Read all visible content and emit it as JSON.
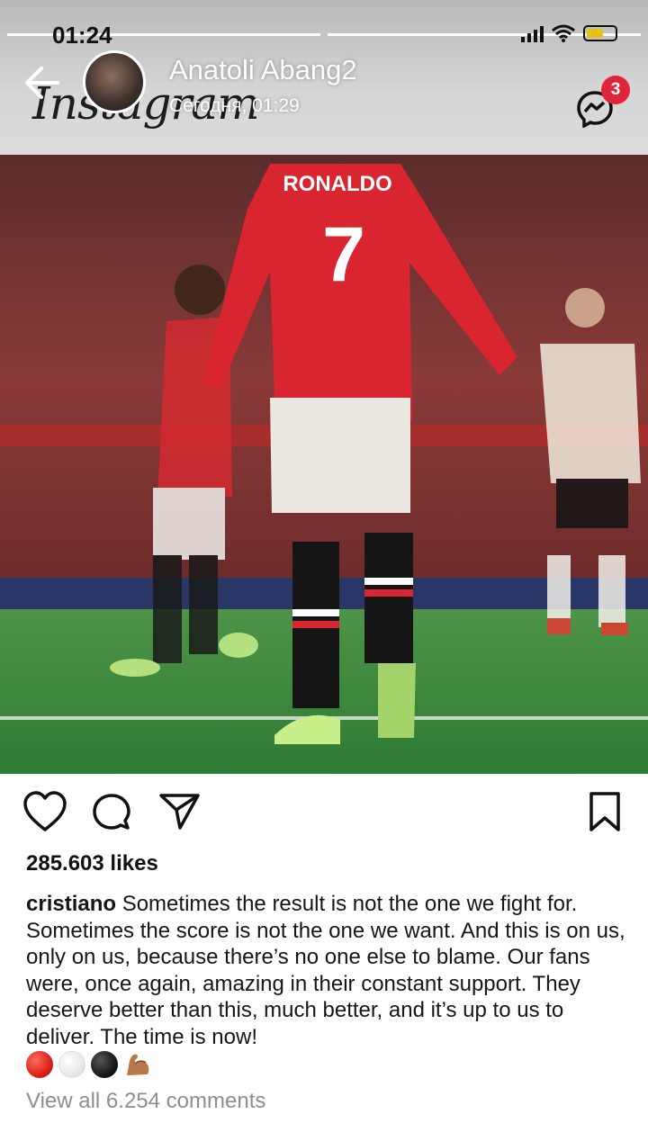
{
  "status_bar": {
    "time": "01:24"
  },
  "chat": {
    "name": "Anatoli Abang2",
    "timestamp": "Сегодня, 01:29",
    "unread_badge": "3"
  },
  "instagram": {
    "wordmark": "Instagram"
  },
  "post": {
    "image_jersey_name": "RONALDO",
    "image_jersey_number": "7",
    "likes": "285.603 likes",
    "username": "cristiano",
    "caption": "Sometimes the result is not the one we fight for. Sometimes the score is not the one we want. And this is on us, only on us, because there’s no one else to blame. Our fans were, once again, amazing in their constant support. They deserve better than this, much better, and it’s up to us to deliver. The time is now!",
    "emojis": [
      "red-circle",
      "white-circle",
      "black-circle",
      "flexed-biceps"
    ],
    "view_comments": "View all 6.254 comments"
  },
  "colors": {
    "badge": "#e0243a",
    "jersey": "#d9252f",
    "pitch": "#3f8a3c"
  }
}
